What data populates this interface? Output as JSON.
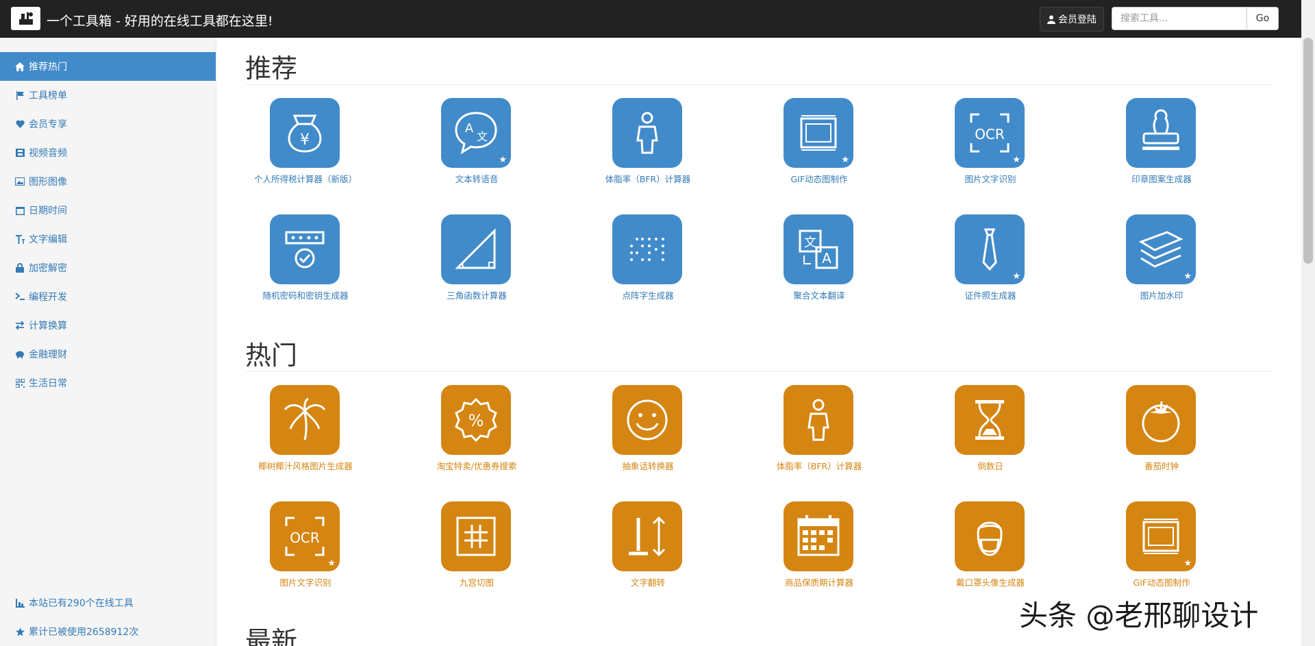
{
  "header": {
    "title": "一个工具箱 - 好用的在线工具都在这里!",
    "login_label": "会员登陆",
    "search_placeholder": "搜索工具...",
    "go_label": "Go"
  },
  "sidebar": {
    "items": [
      {
        "label": "推荐热门",
        "icon": "home-icon",
        "active": true
      },
      {
        "label": "工具榜单",
        "icon": "flag-icon"
      },
      {
        "label": "会员专享",
        "icon": "heart-icon"
      },
      {
        "label": "视频音频",
        "icon": "film-icon"
      },
      {
        "label": "图形图像",
        "icon": "picture-icon"
      },
      {
        "label": "日期时间",
        "icon": "calendar-icon"
      },
      {
        "label": "文字编辑",
        "icon": "text-icon"
      },
      {
        "label": "加密解密",
        "icon": "lock-icon"
      },
      {
        "label": "编程开发",
        "icon": "terminal-icon"
      },
      {
        "label": "计算换算",
        "icon": "transfer-icon"
      },
      {
        "label": "金融理财",
        "icon": "piggy-icon"
      },
      {
        "label": "生活日常",
        "icon": "qrcode-icon"
      }
    ],
    "footer": {
      "tool_count": "本站已有290个在线工具",
      "usage_count": "累计已被使用2658912次"
    }
  },
  "sections": [
    {
      "title": "推荐",
      "color": "#428bca",
      "tools": [
        {
          "label": "个人所得税计算器（新版）",
          "icon": "money-bag-icon",
          "star": false
        },
        {
          "label": "文本转语音",
          "icon": "translate-bubble-icon",
          "star": true
        },
        {
          "label": "体脂率（BFR）计算器",
          "icon": "person-icon",
          "star": false
        },
        {
          "label": "GIF动态图制作",
          "icon": "film-frame-icon",
          "star": true
        },
        {
          "label": "图片文字识别",
          "icon": "ocr-icon",
          "star": true
        },
        {
          "label": "印章图案生成器",
          "icon": "stamp-icon",
          "star": false
        },
        {
          "label": "随机密码和密钥生成器",
          "icon": "password-check-icon",
          "star": false
        },
        {
          "label": "三角函数计算器",
          "icon": "triangle-icon",
          "star": false
        },
        {
          "label": "点阵字生成器",
          "icon": "dot-matrix-icon",
          "star": false
        },
        {
          "label": "聚合文本翻译",
          "icon": "translate-icon",
          "star": false
        },
        {
          "label": "证件照生成器",
          "icon": "tie-icon",
          "star": true
        },
        {
          "label": "图片加水印",
          "icon": "layers-icon",
          "star": true
        }
      ]
    },
    {
      "title": "热门",
      "color": "#d58512",
      "tools": [
        {
          "label": "椰树椰汁风格图片生成器",
          "icon": "palm-tree-icon",
          "star": false
        },
        {
          "label": "淘宝特卖/优惠券搜索",
          "icon": "percent-badge-icon",
          "star": false
        },
        {
          "label": "抽象话转换器",
          "icon": "smile-icon",
          "star": false
        },
        {
          "label": "体脂率（BFR）计算器",
          "icon": "person-icon",
          "star": false
        },
        {
          "label": "倒数日",
          "icon": "hourglass-icon",
          "star": false
        },
        {
          "label": "番茄时钟",
          "icon": "tomato-icon",
          "star": false
        },
        {
          "label": "图片文字识别",
          "icon": "ocr-icon",
          "star": true
        },
        {
          "label": "九宫切图",
          "icon": "grid-icon",
          "star": false
        },
        {
          "label": "文字翻转",
          "icon": "text-flip-icon",
          "star": false
        },
        {
          "label": "商品保质期计算器",
          "icon": "calendar-grid-icon",
          "star": false
        },
        {
          "label": "戴口罩头像生成器",
          "icon": "mask-face-icon",
          "star": false
        },
        {
          "label": "GIF动态图制作",
          "icon": "film-frame-icon",
          "star": true
        }
      ]
    },
    {
      "title": "最新",
      "color": "#333333",
      "tools": []
    }
  ],
  "watermark": "头条 @老邢聊设计"
}
